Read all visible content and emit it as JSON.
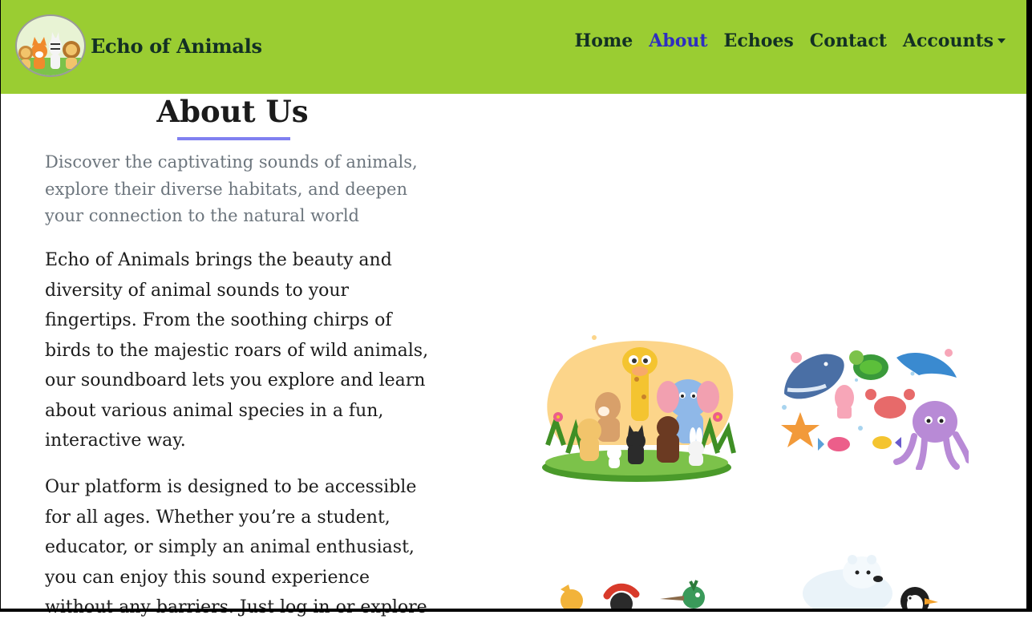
{
  "brand": {
    "name": "Echo of Animals",
    "logo_icon": "animal-friends-logo-icon"
  },
  "nav": {
    "items": [
      {
        "label": "Home",
        "active": false
      },
      {
        "label": "About",
        "active": true
      },
      {
        "label": "Echoes",
        "active": false
      },
      {
        "label": "Contact",
        "active": false
      },
      {
        "label": "Accounts",
        "active": false,
        "dropdown": true
      }
    ]
  },
  "about": {
    "title": "About Us",
    "lead": "Discover the captivating sounds of animals, explore their diverse habitats, and deepen your connection to the natural world",
    "paragraph_1": "Echo of Animals brings the beauty and diversity of animal sounds to your fingertips. From the soothing chirps of birds to the majestic roars of wild animals, our soundboard lets you explore and learn about various animal species in a fun, interactive way.",
    "paragraph_2": "Our platform is designed to be accessible for all ages. Whether you’re a student, educator, or simply an animal enthusiast, you can enjoy this sound experience without any barriers. Just log in or explore"
  },
  "images": {
    "land": "land-animals-illustration",
    "sea": "sea-animals-illustration",
    "birds": "birds-illustration",
    "polar": "polar-animals-illustration"
  },
  "colors": {
    "navbar_bg": "#9acd32",
    "nav_text": "#133024",
    "nav_active": "#2e2ec0",
    "underline": "#8080f0",
    "lead_text": "#6c757d"
  }
}
